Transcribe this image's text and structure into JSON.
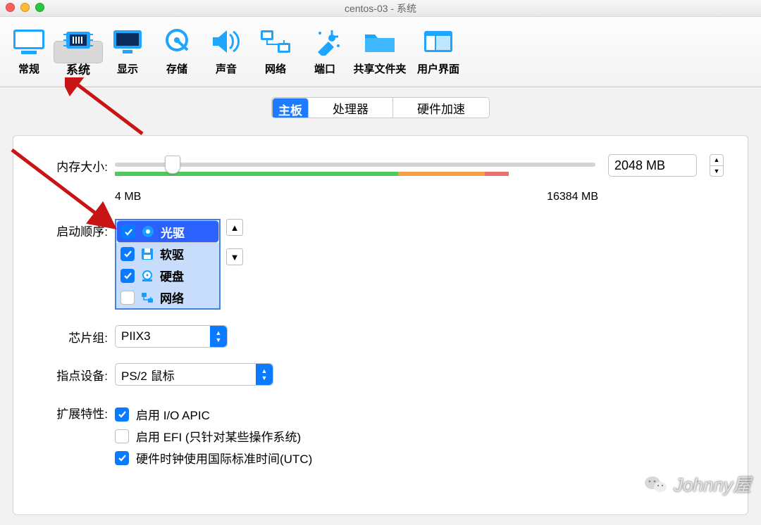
{
  "window": {
    "title": "centos-03 - 系统"
  },
  "toolbar": {
    "items": [
      {
        "label": "常规"
      },
      {
        "label": "系统"
      },
      {
        "label": "显示"
      },
      {
        "label": "存储"
      },
      {
        "label": "声音"
      },
      {
        "label": "网络"
      },
      {
        "label": "端口"
      },
      {
        "label": "共享文件夹"
      },
      {
        "label": "用户界面"
      }
    ]
  },
  "subtabs": [
    "主板",
    "处理器",
    "硬件加速"
  ],
  "memory": {
    "label": "内存大小:",
    "value": "2048 MB",
    "min_label": "4 MB",
    "max_label": "16384 MB",
    "thumb_pct": 12
  },
  "boot": {
    "label": "启动顺序:",
    "items": [
      {
        "label": "光驱",
        "checked": true,
        "selected": true,
        "icon": "disc"
      },
      {
        "label": "软驱",
        "checked": true,
        "selected": false,
        "icon": "floppy"
      },
      {
        "label": "硬盘",
        "checked": true,
        "selected": false,
        "icon": "hdd"
      },
      {
        "label": "网络",
        "checked": false,
        "selected": false,
        "icon": "net"
      }
    ]
  },
  "chipset": {
    "label": "芯片组:",
    "value": "PIIX3"
  },
  "pointing": {
    "label": "指点设备:",
    "value": "PS/2 鼠标"
  },
  "ext": {
    "label": "扩展特性:",
    "opts": [
      {
        "label": "启用 I/O APIC",
        "checked": true
      },
      {
        "label": "启用 EFI (只针对某些操作系统)",
        "checked": false
      },
      {
        "label": "硬件时钟使用国际标准时间(UTC)",
        "checked": true
      }
    ]
  },
  "watermark": "Johnny屋"
}
